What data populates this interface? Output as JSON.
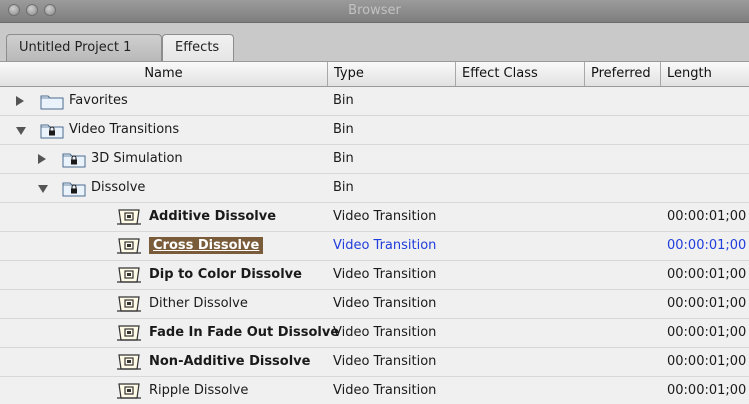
{
  "window": {
    "title": "Browser"
  },
  "tabs": [
    {
      "label": "Untitled Project 1",
      "active": false
    },
    {
      "label": "Effects",
      "active": true
    }
  ],
  "columns": [
    "Name",
    "Type",
    "Effect Class",
    "Preferred",
    "Length"
  ],
  "rows": [
    {
      "name": "Favorites",
      "type": "Bin",
      "length": "",
      "kind": "folder",
      "expand": "collapsed",
      "depth": 0,
      "bold": false,
      "selected": false
    },
    {
      "name": "Video Transitions",
      "type": "Bin",
      "length": "",
      "kind": "locked-folder",
      "expand": "expanded",
      "depth": 0,
      "bold": false,
      "selected": false
    },
    {
      "name": "3D Simulation",
      "type": "Bin",
      "length": "",
      "kind": "locked-folder",
      "expand": "collapsed",
      "depth": 1,
      "bold": false,
      "selected": false
    },
    {
      "name": "Dissolve",
      "type": "Bin",
      "length": "",
      "kind": "locked-folder",
      "expand": "expanded",
      "depth": 1,
      "bold": false,
      "selected": false
    },
    {
      "name": "Additive Dissolve",
      "type": "Video Transition",
      "length": "00:00:01;00",
      "kind": "transition",
      "depth": 2,
      "bold": true,
      "selected": false
    },
    {
      "name": "Cross Dissolve",
      "type": "Video Transition",
      "length": "00:00:01;00",
      "kind": "transition",
      "depth": 2,
      "bold": true,
      "selected": true
    },
    {
      "name": "Dip to Color Dissolve",
      "type": "Video Transition",
      "length": "00:00:01;00",
      "kind": "transition",
      "depth": 2,
      "bold": true,
      "selected": false
    },
    {
      "name": "Dither Dissolve",
      "type": "Video Transition",
      "length": "00:00:01;00",
      "kind": "transition",
      "depth": 2,
      "bold": false,
      "selected": false
    },
    {
      "name": "Fade In Fade Out Dissolve",
      "type": "Video Transition",
      "length": "00:00:01;00",
      "kind": "transition",
      "depth": 2,
      "bold": true,
      "selected": false
    },
    {
      "name": "Non-Additive Dissolve",
      "type": "Video Transition",
      "length": "00:00:01;00",
      "kind": "transition",
      "depth": 2,
      "bold": true,
      "selected": false
    },
    {
      "name": "Ripple Dissolve",
      "type": "Video Transition",
      "length": "00:00:01;00",
      "kind": "transition",
      "depth": 2,
      "bold": false,
      "selected": false
    }
  ],
  "colors": {
    "selected_bg": "#7a5c3a",
    "selected_text": "#1f3ddb"
  }
}
